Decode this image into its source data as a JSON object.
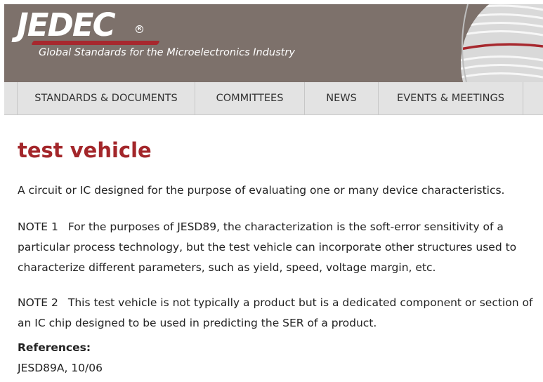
{
  "header": {
    "logo_text": "JEDEC",
    "logo_mark": "R",
    "tagline": "Global Standards for the Microelectronics Industry",
    "colors": {
      "banner": "#7d716b",
      "accent": "#a7282e"
    }
  },
  "nav": {
    "items": [
      {
        "label": "STANDARDS & DOCUMENTS"
      },
      {
        "label": "COMMITTEES"
      },
      {
        "label": "NEWS"
      },
      {
        "label": "EVENTS & MEETINGS"
      }
    ]
  },
  "term": {
    "title": "test vehicle",
    "definition": "A circuit or IC designed for the purpose of evaluating one or many device characteristics.",
    "notes": [
      {
        "label": "NOTE 1",
        "text": "For the purposes of JESD89, the characterization is the soft-error sensitivity of a particular process technology, but the test vehicle can incorporate other structures used to characterize different parameters, such as yield, speed, voltage margin, etc."
      },
      {
        "label": "NOTE 2",
        "text": "This test vehicle is not typically a product but is a dedicated component or section of an IC chip designed to be used in predicting the SER of a product."
      }
    ],
    "references_label": "References:",
    "references": "JESD89A, 10/06",
    "title_color": "#a3262a"
  }
}
